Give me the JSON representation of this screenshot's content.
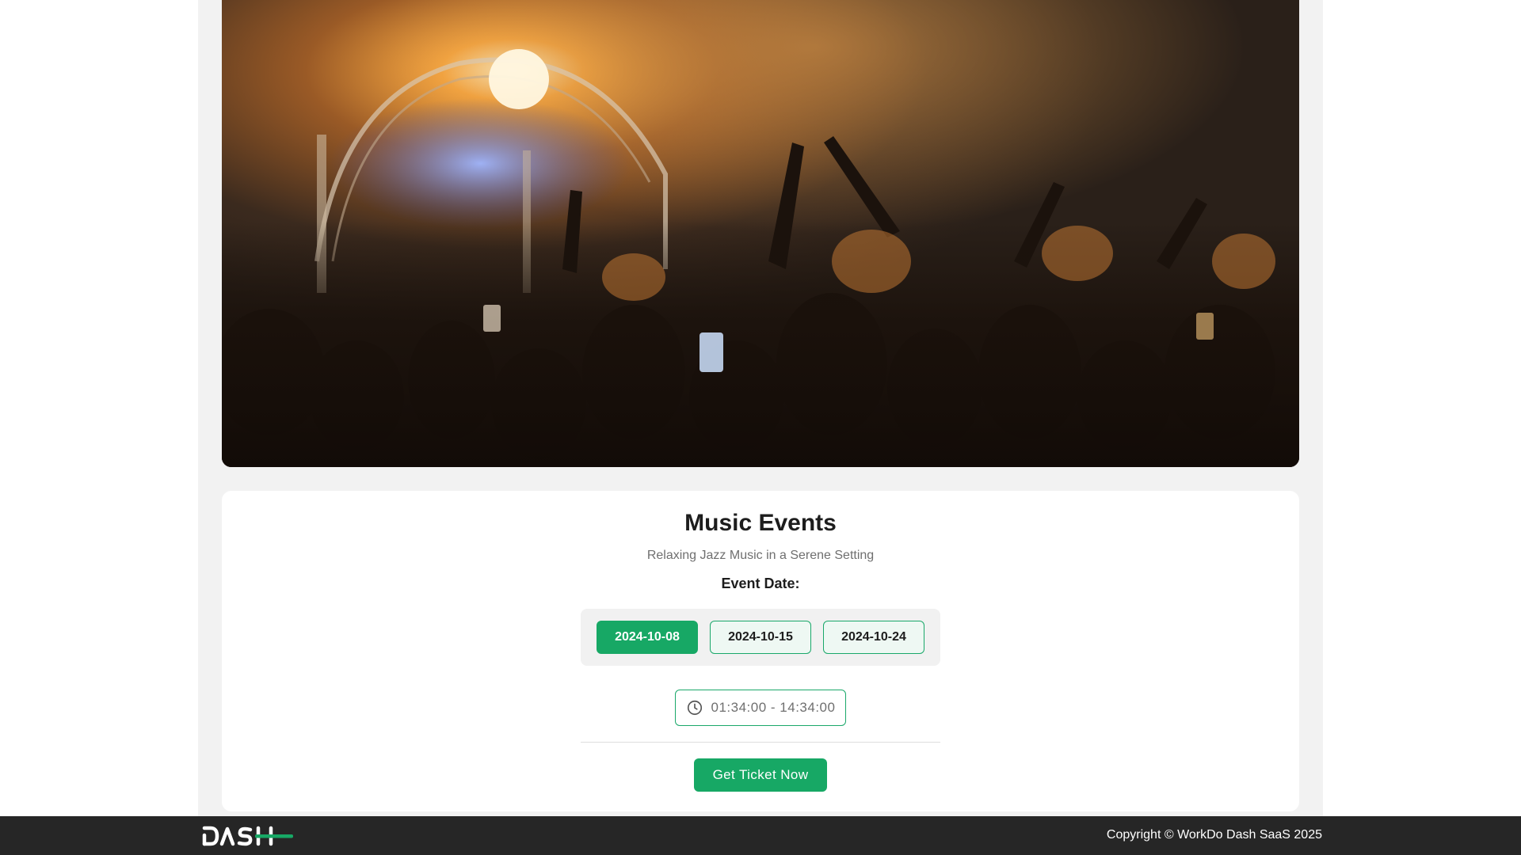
{
  "hero": {
    "image": "concert-crowd-stage-photo"
  },
  "event": {
    "title": "Music Events",
    "subtitle": "Relaxing Jazz Music in a Serene Setting",
    "date_label": "Event Date:",
    "dates": [
      "2024-10-08",
      "2024-10-15",
      "2024-10-24"
    ],
    "selected_date": "2024-10-08",
    "time": "01:34:00 - 14:34:00",
    "time_icon": "clock-icon",
    "ticket_button": "Get Ticket Now"
  },
  "footer": {
    "logo": "DASH",
    "copyright": "Copyright © WorkDo Dash SaaS 2025"
  },
  "colors": {
    "accent": "#17a865",
    "footer_bg": "#262626",
    "page_bg": "#f2f2f2"
  }
}
